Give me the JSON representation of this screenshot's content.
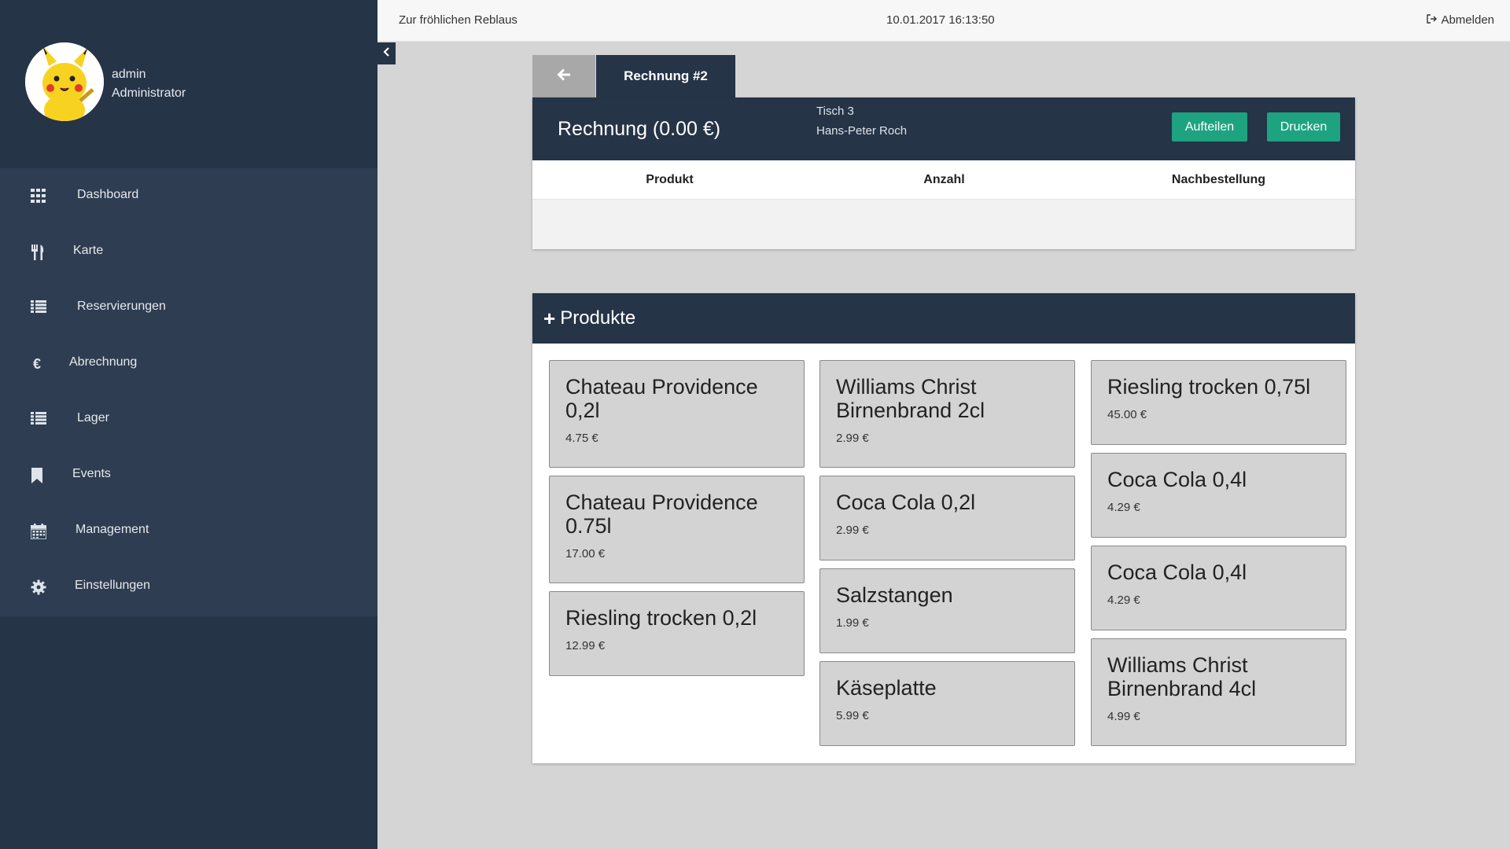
{
  "topbar": {
    "brand": "Zur fröhlichen Reblaus",
    "datetime": "10.01.2017 16:13:50",
    "logout_label": "Abmelden"
  },
  "user": {
    "name": "admin",
    "role": "Administrator"
  },
  "sidebar": {
    "items": [
      {
        "label": "Dashboard",
        "icon": "grid-icon"
      },
      {
        "label": "Karte",
        "icon": "cutlery-icon"
      },
      {
        "label": "Reservierungen",
        "icon": "list-icon"
      },
      {
        "label": "Abrechnung",
        "icon": "euro-icon"
      },
      {
        "label": "Lager",
        "icon": "list-icon"
      },
      {
        "label": "Events",
        "icon": "bookmark-icon"
      },
      {
        "label": "Management",
        "icon": "calendar-icon"
      },
      {
        "label": "Einstellungen",
        "icon": "gear-icon"
      }
    ]
  },
  "tabs": {
    "active_label": "Rechnung #2"
  },
  "invoice": {
    "title": "Rechnung (0.00 €)",
    "table": "Tisch 3",
    "guest": "Hans-Peter Roch",
    "split_label": "Aufteilen",
    "print_label": "Drucken",
    "columns": [
      "Produkt",
      "Anzahl",
      "Nachbestellung"
    ]
  },
  "products": {
    "title": "Produkte",
    "columns": [
      [
        {
          "name": "Chateau Providence 0,2l",
          "price": "4.75 €"
        },
        {
          "name": "Chateau Providence 0.75l",
          "price": "17.00 €"
        },
        {
          "name": "Riesling trocken 0,2l",
          "price": "12.99 €"
        }
      ],
      [
        {
          "name": "Williams Christ Birnenbrand 2cl",
          "price": "2.99 €"
        },
        {
          "name": "Coca Cola 0,2l",
          "price": "2.99 €"
        },
        {
          "name": "Salzstangen",
          "price": "1.99 €"
        },
        {
          "name": "Käseplatte",
          "price": "5.99 €"
        }
      ],
      [
        {
          "name": "Riesling trocken 0,75l",
          "price": "45.00 €"
        },
        {
          "name": "Coca Cola 0,4l",
          "price": "4.29 €"
        },
        {
          "name": "Coca Cola 0,4l",
          "price": "4.29 €"
        },
        {
          "name": "Williams Christ Birnenbrand 4cl",
          "price": "4.99 €"
        }
      ]
    ]
  },
  "colors": {
    "sidebar_bg": "#253447",
    "nav_bg": "#2e3d51",
    "accent_green": "#1ea381",
    "card_bg": "#d3d3d3"
  }
}
